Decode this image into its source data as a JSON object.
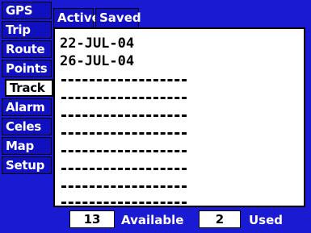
{
  "menu": {
    "items": [
      {
        "label": "GPS"
      },
      {
        "label": "Trip"
      },
      {
        "label": "Route"
      },
      {
        "label": "Points"
      },
      {
        "label": "Track",
        "selected": true
      },
      {
        "label": "Alarm"
      },
      {
        "label": "Celes"
      },
      {
        "label": "Map"
      },
      {
        "label": "Setup"
      }
    ]
  },
  "tabs": {
    "active": "Active",
    "saved": "Saved"
  },
  "tracks": {
    "entries": [
      "22-JUL-04",
      "26-JUL-04"
    ],
    "empty_slots": 8
  },
  "status": {
    "available_count": "13",
    "available_label": "Available",
    "used_count": "2",
    "used_label": "Used"
  },
  "colors": {
    "background": "#1a1ad2",
    "panel": "#ffffff",
    "selected_item": "#ffffff",
    "text_light": "#ffffff",
    "text_dark": "#000000"
  }
}
